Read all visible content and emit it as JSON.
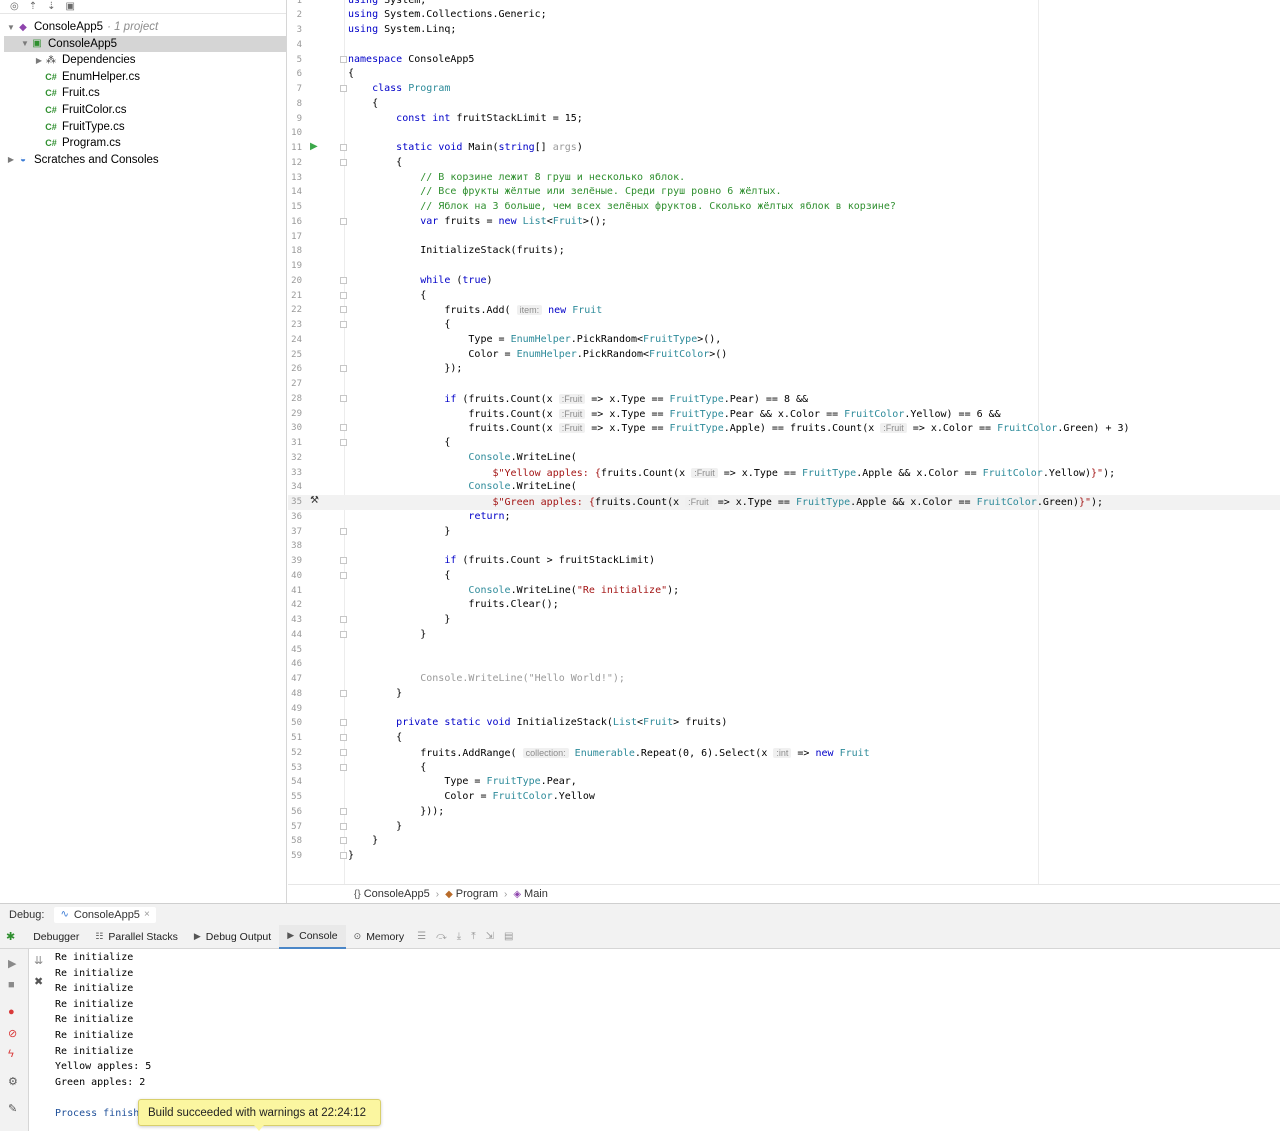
{
  "project_tree": {
    "items": [
      {
        "label": "ConsoleApp5",
        "extra": "· 1 project",
        "icon": "solution-icon",
        "depth": 0,
        "expanded": true,
        "selected": false
      },
      {
        "label": "ConsoleApp5",
        "extra": "",
        "icon": "csharp-project-icon",
        "depth": 1,
        "expanded": true,
        "selected": true
      },
      {
        "label": "Dependencies",
        "extra": "",
        "icon": "dependencies-icon",
        "depth": 2,
        "expanded": false,
        "selected": false
      },
      {
        "label": "EnumHelper.cs",
        "extra": "",
        "icon": "csharp-file-icon",
        "depth": 2,
        "selected": false
      },
      {
        "label": "Fruit.cs",
        "extra": "",
        "icon": "csharp-file-icon",
        "depth": 2,
        "selected": false
      },
      {
        "label": "FruitColor.cs",
        "extra": "",
        "icon": "csharp-file-icon",
        "depth": 2,
        "selected": false
      },
      {
        "label": "FruitType.cs",
        "extra": "",
        "icon": "csharp-file-icon",
        "depth": 2,
        "selected": false
      },
      {
        "label": "Program.cs",
        "extra": "",
        "icon": "csharp-file-icon",
        "depth": 2,
        "selected": false
      },
      {
        "label": "Scratches and Consoles",
        "extra": "",
        "icon": "scratches-icon",
        "depth": 0,
        "expanded": false,
        "selected": false
      }
    ]
  },
  "editor": {
    "current_line": 35,
    "lines": [
      "<span class=\"kw\">using</span> System;",
      "<span class=\"kw\">using</span> System.Collections.Generic;",
      "<span class=\"kw\">using</span> System.Linq;",
      "",
      "<span class=\"kw\">namespace</span> ConsoleApp5",
      "{",
      "    <span class=\"kw\">class</span> <span class=\"ty\">Program</span>",
      "    {",
      "        <span class=\"kw\">const int</span> fruitStackLimit = 15;",
      "",
      "        <span class=\"kw\">static void</span> Main(<span class=\"kw\">string</span>[] <span class=\"dim\">args</span>)",
      "        {",
      "            <span class=\"cmt\">// В корзине лежит 8 груш и несколько яблок.</span>",
      "            <span class=\"cmt\">// Все фрукты жёлтые или зелёные. Среди груш ровно 6 жёлтых.</span>",
      "            <span class=\"cmt\">// Яблок на 3 больше, чем всех зелёных фруктов. Сколько жёлтых яблок в корзине?</span>",
      "            <span class=\"kw\">var</span> fruits = <span class=\"kw\">new</span> <span class=\"ty\">List</span>&lt;<span class=\"ty\">Fruit</span>&gt;();",
      "",
      "            InitializeStack(fruits);",
      "",
      "            <span class=\"kw\">while</span> (<span class=\"kw\">true</span>)",
      "            {",
      "                fruits.Add( <span class=\"hint\">item:</span> <span class=\"kw\">new</span> <span class=\"ty\">Fruit</span>",
      "                {",
      "                    Type = <span class=\"ty\">EnumHelper</span>.PickRandom&lt;<span class=\"ty\">FruitType</span>&gt;(),",
      "                    Color = <span class=\"ty\">EnumHelper</span>.PickRandom&lt;<span class=\"ty\">FruitColor</span>&gt;()",
      "                });",
      "",
      "                <span class=\"kw\">if</span> (fruits.Count(x <span class=\"hint\">:Fruit</span> =&gt; x.Type == <span class=\"ty\">FruitType</span>.Pear) == 8 &amp;&amp;",
      "                    fruits.Count(x <span class=\"hint\">:Fruit</span> =&gt; x.Type == <span class=\"ty\">FruitType</span>.Pear &amp;&amp; x.Color == <span class=\"ty\">FruitColor</span>.Yellow) == 6 &amp;&amp;",
      "                    fruits.Count(x <span class=\"hint\">:Fruit</span> =&gt; x.Type == <span class=\"ty\">FruitType</span>.Apple) == fruits.Count(x <span class=\"hint\">:Fruit</span> =&gt; x.Color == <span class=\"ty\">FruitColor</span>.Green) + 3)",
      "                {",
      "                    <span class=\"ty\">Console</span>.WriteLine(",
      "                        <span class=\"str\">$\"Yellow apples: {</span>fruits.Count(x <span class=\"hint\">:Fruit</span> =&gt; x.Type == <span class=\"ty\">FruitType</span>.Apple &amp;&amp; x.Color == <span class=\"ty\">FruitColor</span>.Yellow)<span class=\"str\">}\"</span>);",
      "                    <span class=\"ty\">Console</span>.WriteLine(",
      "                        <span class=\"str\">$\"Green apples: {</span>fruits.Count(x <span class=\"hint\">:Fruit</span> =&gt; x.Type == <span class=\"ty\">FruitType</span>.Apple &amp;&amp; x.Color == <span class=\"ty\">FruitColor</span>.Green)<span class=\"str\">}\"</span>);",
      "                    <span class=\"kw\">return</span>;",
      "                }",
      "",
      "                <span class=\"kw\">if</span> (fruits.Count &gt; fruitStackLimit)",
      "                {",
      "                    <span class=\"ty\">Console</span>.WriteLine(<span class=\"str\">\"Re initialize\"</span>);",
      "                    fruits.Clear();",
      "                }",
      "            }",
      "",
      "",
      "            <span class=\"dim\">Console.WriteLine(\"Hello World!\");</span>",
      "        }",
      "",
      "        <span class=\"kw\">private static void</span> InitializeStack(<span class=\"ty\">List</span>&lt;<span class=\"ty\">Fruit</span>&gt; fruits)",
      "        {",
      "            fruits.AddRange( <span class=\"hint\">collection:</span> <span class=\"ty\">Enumerable</span>.Repeat(0, 6).Select(x <span class=\"hint\">:int</span> =&gt; <span class=\"kw\">new</span> <span class=\"ty\">Fruit</span>",
      "            {",
      "                Type = <span class=\"ty\">FruitType</span>.Pear,",
      "                Color = <span class=\"ty\">FruitColor</span>.Yellow",
      "            }));",
      "        }",
      "    }",
      "}"
    ],
    "fold_lines": [
      5,
      7,
      11,
      12,
      16,
      20,
      21,
      22,
      23,
      26,
      28,
      30,
      31,
      37,
      39,
      40,
      43,
      44,
      48,
      50,
      51,
      52,
      53,
      56,
      57,
      58,
      59
    ]
  },
  "breadcrumb": {
    "namespace": "ConsoleApp5",
    "class": "Program",
    "method": "Main",
    "separator": "›"
  },
  "debug": {
    "label": "Debug:",
    "session": "ConsoleApp5",
    "tabs": [
      "Debugger",
      "Parallel Stacks",
      "Debug Output",
      "Console",
      "Memory"
    ],
    "active_tab": "Console",
    "console_lines": [
      "Re initialize",
      "Re initialize",
      "Re initialize",
      "Re initialize",
      "Re initialize",
      "Re initialize",
      "Re initialize",
      "Yellow apples: 5",
      "Green apples: 2",
      "",
      "Process finished"
    ]
  },
  "tooltip": {
    "text": "Build succeeded with warnings at 22:24:12"
  },
  "colors": {
    "keyword": "#0000c8",
    "type": "#2e8b9a",
    "string": "#a31515",
    "comment": "#2f8f2f",
    "selection": "#d5d5d5",
    "tooltip_bg": "#fbf6a0",
    "run_icon": "#3ba84a"
  }
}
